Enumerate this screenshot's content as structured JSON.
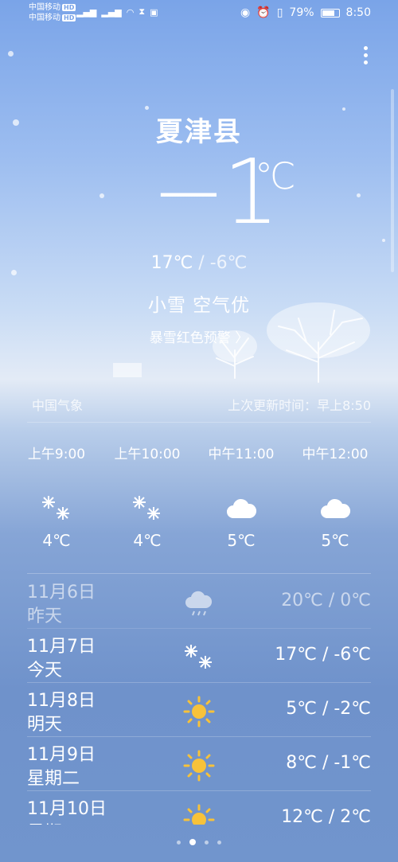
{
  "status": {
    "carrier1": "中国移动",
    "carrier2": "中国移动",
    "hd": "HD",
    "battery": "79%",
    "battery_level": 0.79,
    "time": "8:50"
  },
  "main": {
    "city": "夏津县",
    "temp": "−1",
    "unit": "℃",
    "high": "17℃",
    "sep": " / ",
    "low": "-6℃",
    "condition": "小雪",
    "air": "空气优",
    "alert": "暴雪红色预警 〉"
  },
  "source": {
    "provider": "中国气象",
    "updated": "上次更新时间：早上8:50"
  },
  "hourly": [
    {
      "time": "上午9:00",
      "icon": "snow-icon",
      "temp": "4℃"
    },
    {
      "time": "上午10:00",
      "icon": "snow-icon",
      "temp": "4℃"
    },
    {
      "time": "中午11:00",
      "icon": "cloud-icon",
      "temp": "5℃"
    },
    {
      "time": "中午12:00",
      "icon": "cloud-icon",
      "temp": "5℃"
    }
  ],
  "daily": [
    {
      "date": "11月6日",
      "label": "昨天",
      "icon": "rain-cloud-icon",
      "temp": "20℃ / 0℃"
    },
    {
      "date": "11月7日",
      "label": "今天",
      "icon": "snow-icon",
      "temp": "17℃ / -6℃"
    },
    {
      "date": "11月8日",
      "label": "明天",
      "icon": "sun-icon",
      "temp": "5℃ / -2℃"
    },
    {
      "date": "11月9日",
      "label": "星期二",
      "icon": "sun-icon",
      "temp": "8℃ / -1℃"
    },
    {
      "date": "11月10日",
      "label": "星期三",
      "icon": "sun-icon",
      "temp": "12℃ / 2℃"
    }
  ],
  "colors": {
    "sun": "#f7c23a",
    "snow": "#ffffff"
  }
}
